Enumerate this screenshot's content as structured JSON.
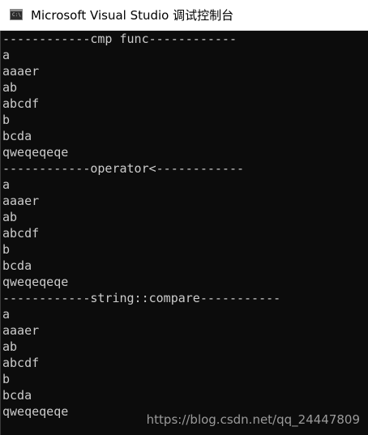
{
  "window": {
    "title": "Microsoft Visual Studio 调试控制台",
    "icon": "console-app-icon",
    "icon_glyph": "C:\\"
  },
  "console": {
    "lines": [
      "------------cmp func------------",
      "a",
      "aaaer",
      "ab",
      "abcdf",
      "b",
      "bcda",
      "qweqeqeqe",
      "------------operator<------------",
      "a",
      "aaaer",
      "ab",
      "abcdf",
      "b",
      "bcda",
      "qweqeqeqe",
      "------------string::compare-----------",
      "a",
      "aaaer",
      "ab",
      "abcdf",
      "b",
      "bcda",
      "qweqeqeqe"
    ]
  },
  "watermark": "https://blog.csdn.net/qq_24447809",
  "colors": {
    "background": "#0c0c0c",
    "text": "#cccccc",
    "titlebar": "#ffffff"
  }
}
